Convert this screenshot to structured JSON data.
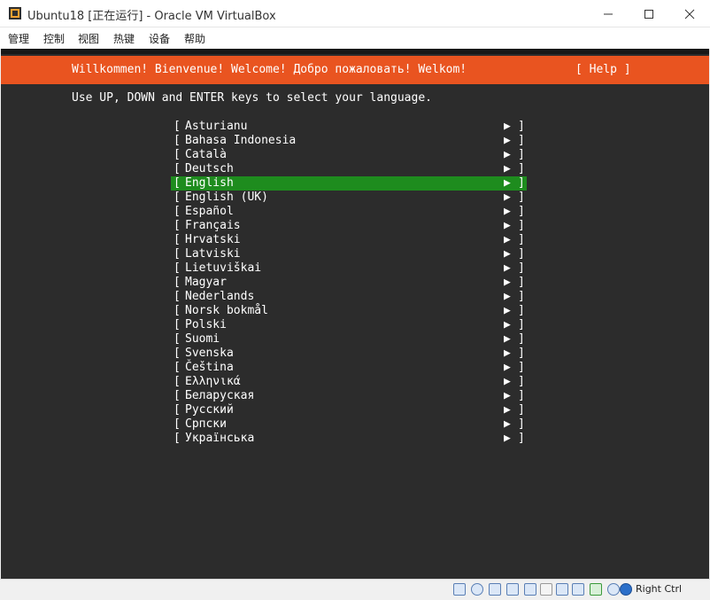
{
  "window": {
    "title": "Ubuntu18 [正在运行] - Oracle VM VirtualBox",
    "icon": "virtualbox-icon"
  },
  "menu": [
    "管理",
    "控制",
    "视图",
    "热键",
    "设备",
    "帮助"
  ],
  "installer": {
    "header": "Willkommen! Bienvenue! Welcome! Добро пожаловать! Welkom!",
    "help": "[ Help ]",
    "instructions": "Use UP, DOWN and ENTER keys to select your language.",
    "selected": "English",
    "languages": [
      "Asturianu",
      "Bahasa Indonesia",
      "Català",
      "Deutsch",
      "English",
      "English (UK)",
      "Español",
      "Français",
      "Hrvatski",
      "Latviski",
      "Lietuviškai",
      "Magyar",
      "Nederlands",
      "Norsk bokmål",
      "Polski",
      "Suomi",
      "Svenska",
      "Čeština",
      "Ελληνικά",
      "Беларуская",
      "Русский",
      "Српски",
      "Українська"
    ],
    "bracket_open": "[",
    "bracket_close": "]",
    "arrow": "▶"
  },
  "statusbar": {
    "host_key": "Right Ctrl"
  },
  "colors": {
    "header_bg": "#e95420",
    "selection_bg": "#1e8c1e",
    "screen_bg": "#2c2c2c"
  }
}
